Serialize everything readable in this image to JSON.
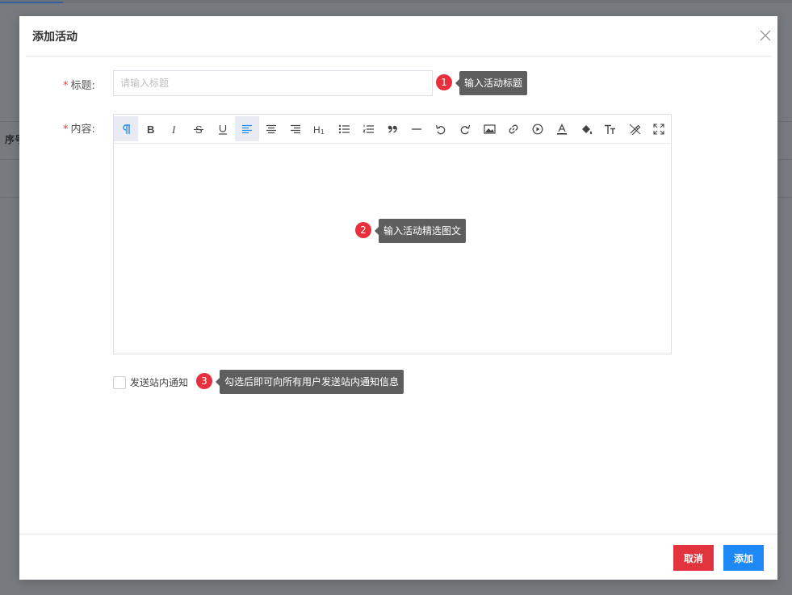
{
  "background": {
    "table_header_first_col": "序号"
  },
  "dialog": {
    "title": "添加活动",
    "form": {
      "title_label": "标题:",
      "title_placeholder": "请输入标题",
      "content_label": "内容:",
      "notify_label": "发送站内通知"
    },
    "toolbar": [
      {
        "name": "paragraph-icon",
        "active": true
      },
      {
        "name": "bold-icon"
      },
      {
        "name": "italic-icon"
      },
      {
        "name": "strikethrough-icon"
      },
      {
        "name": "underline-icon"
      },
      {
        "name": "align-left-icon",
        "active": true
      },
      {
        "name": "align-center-icon"
      },
      {
        "name": "align-right-icon"
      },
      {
        "name": "heading-icon"
      },
      {
        "name": "bullet-list-icon"
      },
      {
        "name": "numbered-list-icon"
      },
      {
        "name": "quote-icon"
      },
      {
        "name": "horizontal-rule-icon"
      },
      {
        "name": "undo-icon"
      },
      {
        "name": "redo-icon"
      },
      {
        "name": "image-icon"
      },
      {
        "name": "link-icon"
      },
      {
        "name": "video-icon"
      },
      {
        "name": "font-color-icon"
      },
      {
        "name": "fill-color-icon"
      },
      {
        "name": "font-size-icon"
      },
      {
        "name": "clear-format-icon"
      },
      {
        "name": "fullscreen-icon"
      }
    ],
    "hints": [
      {
        "number": "1",
        "text": "输入活动标题"
      },
      {
        "number": "2",
        "text": "输入活动精选图文"
      },
      {
        "number": "3",
        "text": "勾选后即可向所有用户发送站内通知信息"
      }
    ],
    "footer": {
      "cancel_label": "取消",
      "add_label": "添加"
    },
    "colors": {
      "required_star": "#e4393c",
      "cancel_button": "#e2343f",
      "add_button": "#1e88f5",
      "hint_badge": "#e8303c",
      "hint_tip": "#5e5e5e"
    }
  }
}
